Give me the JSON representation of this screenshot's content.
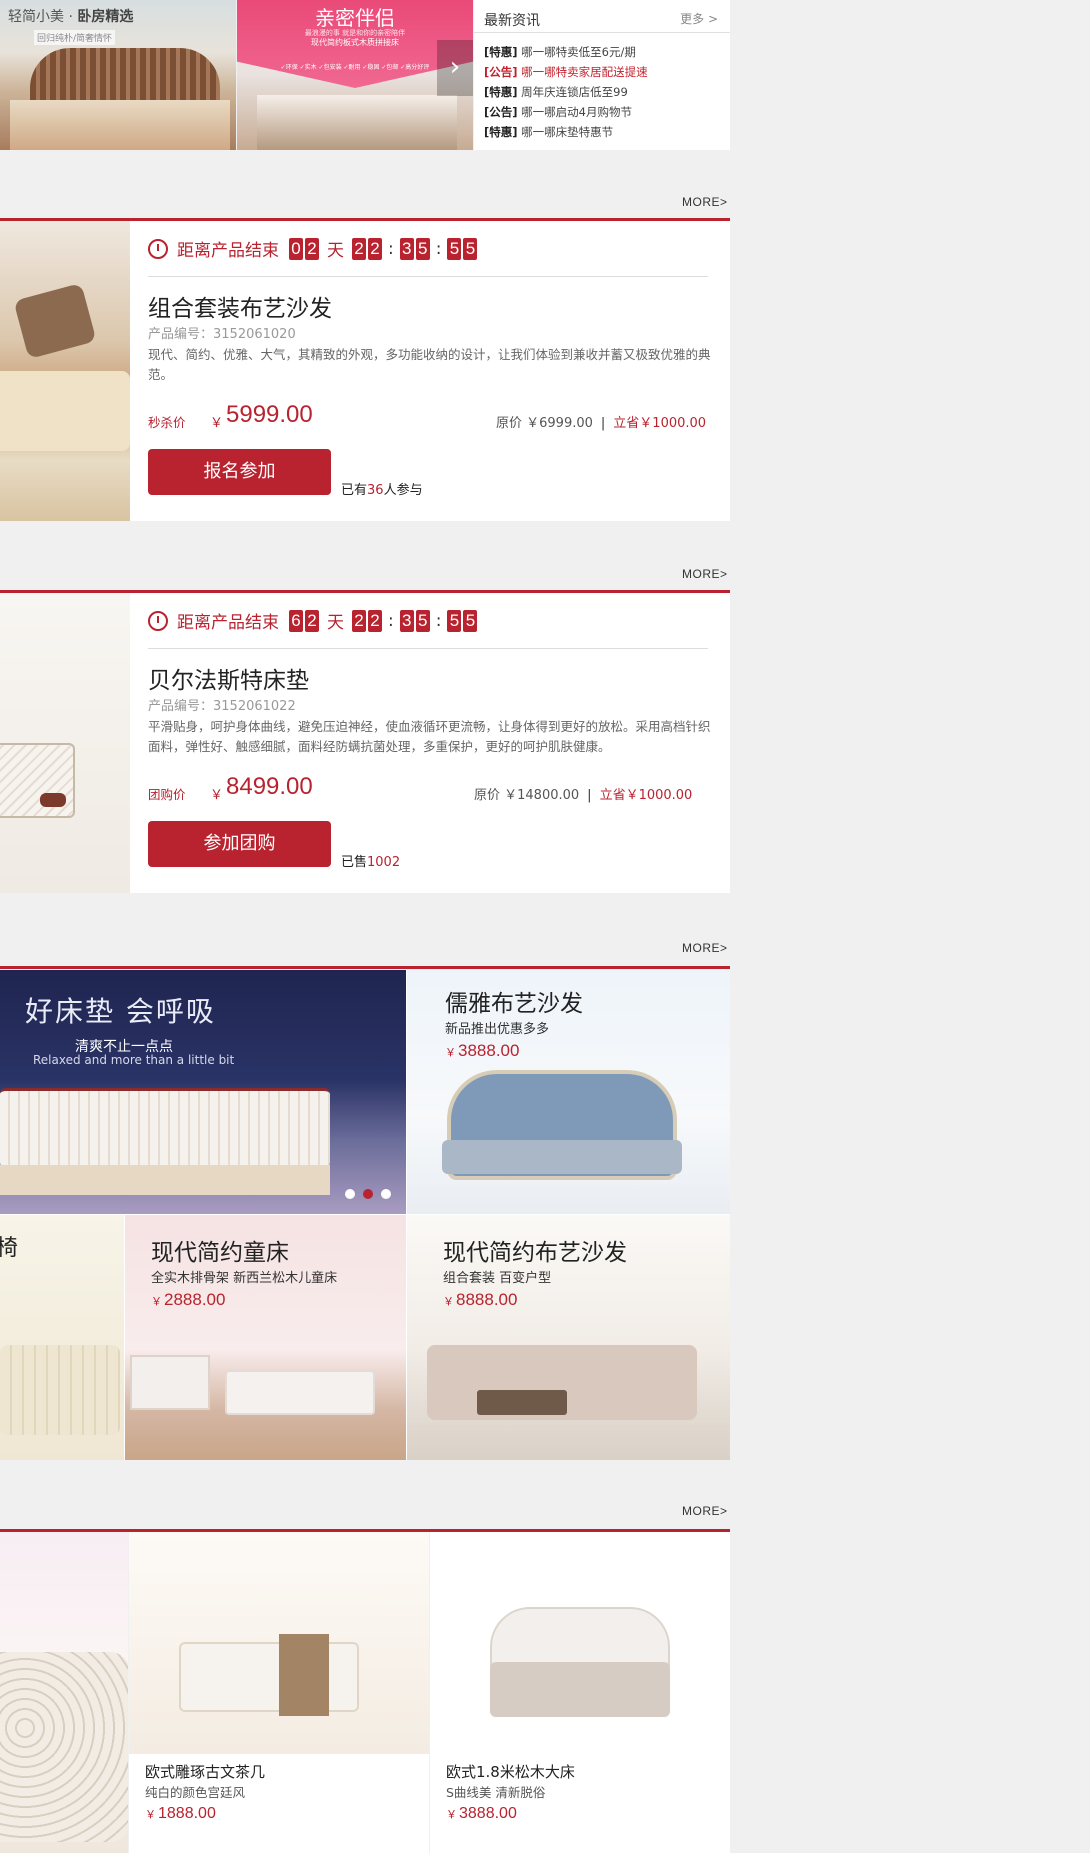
{
  "colors": {
    "accent": "#b8232f",
    "background": "#f0f0f0"
  },
  "banner1": {
    "title_light": "轻简小美 · ",
    "title_bold": "卧房精选",
    "subtitle": "回归纯朴/简奢情怀"
  },
  "banner2": {
    "title": "亲密伴侣",
    "line1": "最浪漫的事 就是和你的亲密陪伴",
    "line2": "现代简约板式木质拼接床",
    "line3": "✓环保 ✓实木 ✓包安装 ✓耐用 ✓稳固 ✓包邮 ✓高分好评",
    "next_icon": "chevron-right-icon"
  },
  "news": {
    "title": "最新资讯",
    "more": "更多 >",
    "items": [
      {
        "tag": "[特惠]",
        "text": " 哪一哪特卖低至6元/期",
        "highlight": false
      },
      {
        "tag": "[公告]",
        "text": " 哪一哪特卖家居配送提速",
        "highlight": true
      },
      {
        "tag": "[特惠]",
        "text": " 周年庆连锁店低至99",
        "highlight": false
      },
      {
        "tag": "[公告]",
        "text": " 哪一哪启动4月购物节",
        "highlight": false
      },
      {
        "tag": "[特惠]",
        "text": " 哪一哪床垫特惠节",
        "highlight": false
      }
    ]
  },
  "sections": {
    "more_label": "MORE>"
  },
  "countdown": {
    "label": "距离产品结束",
    "day_unit": "天",
    "sep": ":"
  },
  "product1": {
    "days": [
      "0",
      "2"
    ],
    "hours": [
      "2",
      "2"
    ],
    "minutes": [
      "3",
      "5"
    ],
    "seconds": [
      "5",
      "5"
    ],
    "name": "组合套装布艺沙发",
    "code": "产品编号：3152061020",
    "desc": "现代、简约、优雅、大气，其精致的外观，多功能收纳的设计，让我们体验到兼收并蓄又极致优雅的典范。",
    "type_label": "秒杀价",
    "yen": "￥",
    "price": "5999.00",
    "orig": "原价 ￥6999.00",
    "bar": "|",
    "save": "立省￥1000.00",
    "button": "报名参加",
    "joined_prefix": "已有",
    "joined_count": "36",
    "joined_suffix": "人参与"
  },
  "product2": {
    "days": [
      "6",
      "2"
    ],
    "hours": [
      "2",
      "2"
    ],
    "minutes": [
      "3",
      "5"
    ],
    "seconds": [
      "5",
      "5"
    ],
    "name": "贝尔法斯特床垫",
    "code": "产品编号：3152061022",
    "desc": "平滑贴身，呵护身体曲线，避免压迫神经，使血液循环更流畅，让身体得到更好的放松。采用高档针织面料，弹性好、触感细腻，面料经防螨抗菌处理，多重保护，更好的呵护肌肤健康。",
    "type_label": "团购价",
    "yen": "￥",
    "price": "8499.00",
    "orig": "原价 ￥14800.00",
    "bar": "|",
    "save": "立省￥1000.00",
    "button": "参加团购",
    "joined_prefix": "已售",
    "joined_count": "1002"
  },
  "promo": {
    "mattress": {
      "title": "好床垫 会呼吸",
      "sub_cn": "清爽不止一点点",
      "sub_en": "Relaxed and more than a little bit",
      "slide_active": 2
    },
    "sofa1": {
      "title": "儒雅布艺沙发",
      "sub": "新品推出优惠多多",
      "yen": "￥",
      "price": "3888.00"
    },
    "dining": {
      "title_cut": "椅"
    },
    "kids": {
      "title": "现代简约童床",
      "sub": "全实木排骨架 新西兰松木儿童床",
      "yen": "￥",
      "price": "2888.00"
    },
    "sofa2": {
      "title": "现代简约布艺沙发",
      "sub": "组合套装 百变户型",
      "yen": "￥",
      "price": "8888.00"
    }
  },
  "bottom": [
    {
      "name": "欧式雕琢古文茶几",
      "sub": "纯白的颜色宫廷风",
      "yen": "￥",
      "price": "1888.00"
    },
    {
      "name": "欧式1.8米松木大床",
      "sub": "S曲线美 清新脱俗",
      "yen": "￥",
      "price": "3888.00"
    }
  ]
}
